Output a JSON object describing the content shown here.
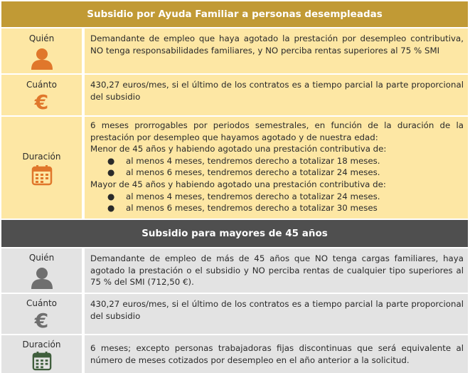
{
  "section1": {
    "title": "Subsidio por Ayuda Familiar a personas desempleadas",
    "rows": {
      "quien": {
        "label": "Quién",
        "icon": "person-icon",
        "text": "Demandante de empleo que haya agotado la prestación por desempleo contributiva, NO tenga responsabilidades familiares, y NO perciba rentas superiores al 75 % SMI"
      },
      "cuanto": {
        "label": "Cuánto",
        "icon": "euro-icon",
        "text": "430,27 euros/mes, si el último de los contratos es a tiempo parcial la parte proporcional del subsidio"
      },
      "duracion": {
        "label": "Duración",
        "icon": "calendar-icon",
        "intro": "6 meses prorrogables por periodos semestrales, en función de la duración de la prestación por desempleo que hayamos agotado y de nuestra edad:",
        "under45": "Menor de 45 años y habiendo agotado una prestación contributiva de:",
        "under45_items": [
          "al menos 4 meses, tendremos derecho a totalizar 18 meses.",
          "al menos 6 meses, tendremos derecho a totalizar 24 meses."
        ],
        "over45": "Mayor de 45 años y habiendo agotado una prestación contributiva de:",
        "over45_items": [
          "al menos 4 meses, tendremos derecho a totalizar 24 meses.",
          "al menos 6 meses, tendremos derecho a totalizar 30 meses"
        ]
      }
    }
  },
  "section2": {
    "title": "Subsidio para mayores de 45 años",
    "rows": {
      "quien": {
        "label": "Quién",
        "icon": "person-icon",
        "text": "Demandante de empleo de más de 45 años que NO tenga cargas familiares, haya agotado la prestación o el subsidio y NO perciba rentas de cualquier tipo superiores al 75 % del SMI (712,50 €)."
      },
      "cuanto": {
        "label": "Cuánto",
        "icon": "euro-icon",
        "text": "430,27 euros/mes, si el último de los contratos es a tiempo parcial la parte proporcional del subsidio"
      },
      "duracion": {
        "label": "Duración",
        "icon": "calendar-icon",
        "text": "6 meses; excepto personas trabajadoras fijas discontinuas que será equivalente al número de meses cotizados por desempleo en el año anterior a la solicitud."
      }
    }
  },
  "colors": {
    "header1": "#c19a35",
    "header2": "#4f4f4f",
    "amber_bg": "#fde7a4",
    "gray_bg": "#e3e3e3",
    "icon_orange": "#e0772b",
    "icon_gray": "#6f6f6f",
    "icon_green": "#3f5e3c"
  }
}
